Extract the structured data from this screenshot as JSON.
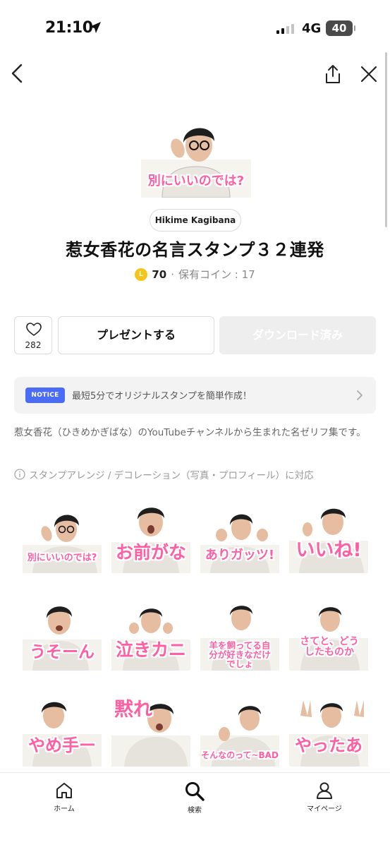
{
  "status": {
    "time": "21:10",
    "network": "4G",
    "battery": "40"
  },
  "hero": {
    "caption": "別にいいのでは?"
  },
  "author": "Hikime Kagibana",
  "title": "惹女香花の名言スタンプ３２連発",
  "price": {
    "coin_symbol": "L",
    "amount": "70",
    "separator": "·",
    "owned": "保有コイン : 17"
  },
  "actions": {
    "like_count": "282",
    "present": "プレゼントする",
    "download": "ダウンロード済み"
  },
  "notice": {
    "badge": "NOTICE",
    "text": "最短5分でオリジナルスタンプを簡単作成！"
  },
  "description": "惹女香花（ひきめかぎばな）のYouTubeチャンネルから生まれた名ゼリフ集です。",
  "arrange_note": "スタンプアレンジ / デコレーション（写真・プロフィール）に対応",
  "stickers": [
    {
      "caption": "別にいいのでは?"
    },
    {
      "caption": "お前がな"
    },
    {
      "caption": "ありガッツ!"
    },
    {
      "caption": "いいね!"
    },
    {
      "caption": "うそーん"
    },
    {
      "caption": "泣きカニ"
    },
    {
      "caption": "羊を飼ってる自分が好きなだけでしょ"
    },
    {
      "caption": "さてと、どうしたものか"
    },
    {
      "caption": "やめ手ー"
    },
    {
      "caption": "黙れ"
    },
    {
      "caption": "そんなのって~BAD"
    },
    {
      "caption": "やったあ"
    }
  ],
  "tabs": [
    {
      "label": "ホーム",
      "icon": "home-icon"
    },
    {
      "label": "検索",
      "icon": "search-icon"
    },
    {
      "label": "マイページ",
      "icon": "person-icon"
    }
  ],
  "colors": {
    "accent_pink": "#ff5fa2",
    "notice_blue": "#4a6cf7",
    "coin_yellow": "#f5c518"
  }
}
